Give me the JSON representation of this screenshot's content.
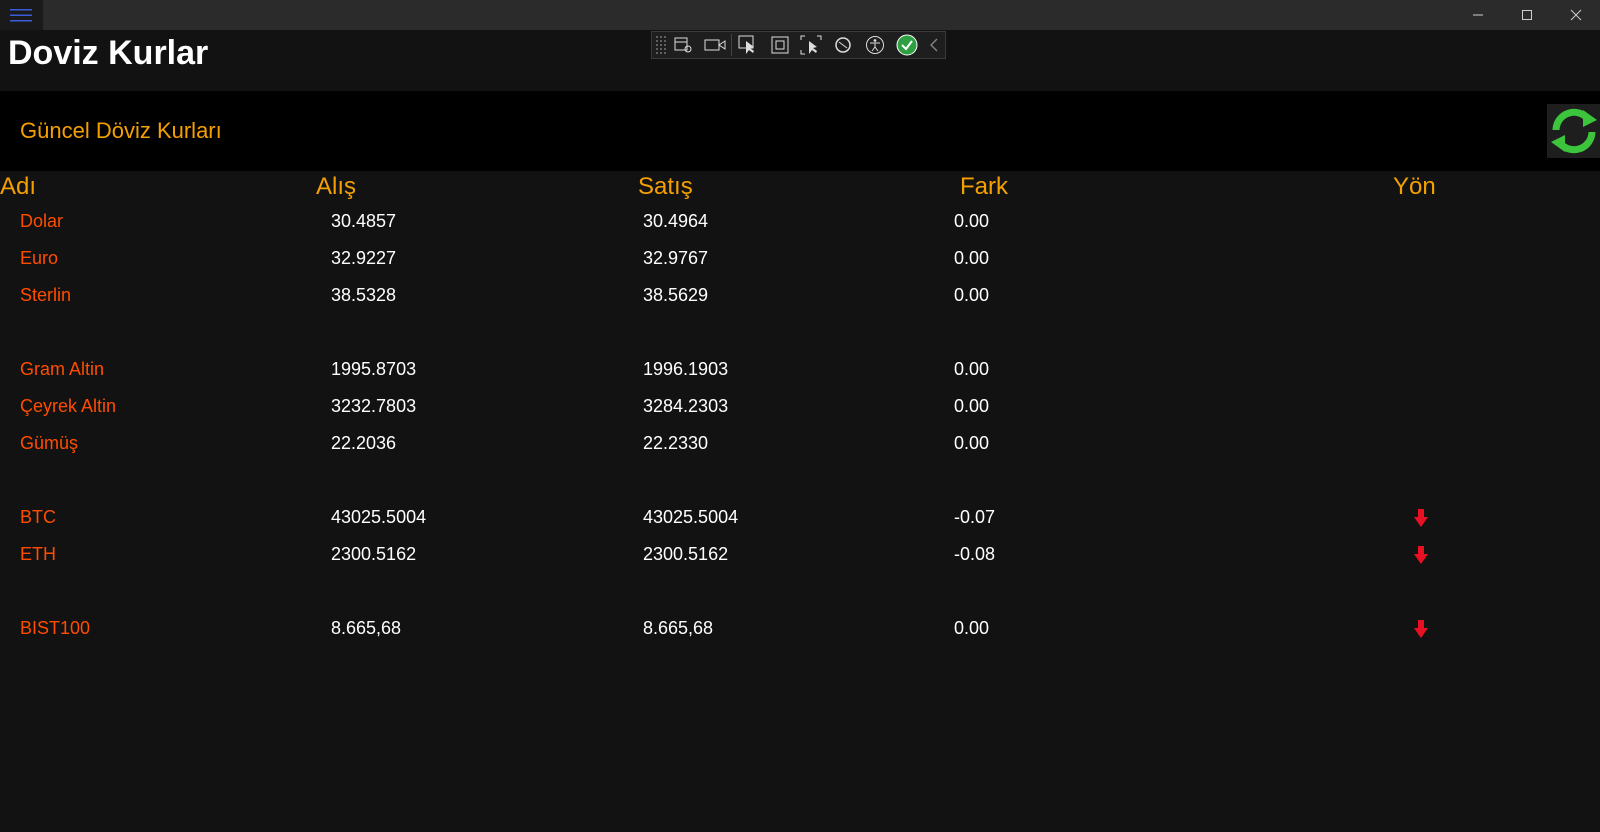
{
  "window": {
    "title": "Doviz Kurlar"
  },
  "devtools": {
    "icons": [
      "live-visual-tree-icon",
      "record-icon",
      "select-element-icon",
      "layout-adorner-icon",
      "track-focus-icon",
      "binding-failures-icon",
      "accessibility-icon",
      "check-icon",
      "collapse-icon"
    ]
  },
  "header": {
    "section_title": "Güncel Döviz Kurları",
    "refresh_icon": "refresh-icon",
    "accent_color": "#f5a000"
  },
  "table": {
    "columns": [
      "Adı",
      "Alış",
      "Satış",
      "Fark",
      "Yön"
    ],
    "rows": [
      {
        "name": "Dolar",
        "buy": "30.4857",
        "sell": "30.4964",
        "diff": "0.00",
        "direction": ""
      },
      {
        "name": "Euro",
        "buy": "32.9227",
        "sell": "32.9767",
        "diff": "0.00",
        "direction": ""
      },
      {
        "name": "Sterlin",
        "buy": "38.5328",
        "sell": "38.5629",
        "diff": "0.00",
        "direction": ""
      },
      {
        "name": "Gram Altin",
        "buy": "1995.8703",
        "sell": "1996.1903",
        "diff": "0.00",
        "direction": ""
      },
      {
        "name": "Çeyrek Altin",
        "buy": "3232.7803",
        "sell": "3284.2303",
        "diff": "0.00",
        "direction": ""
      },
      {
        "name": "Gümüş",
        "buy": "22.2036",
        "sell": "22.2330",
        "diff": "0.00",
        "direction": ""
      },
      {
        "name": "BTC",
        "buy": "43025.5004",
        "sell": "43025.5004",
        "diff": "-0.07",
        "direction": "down"
      },
      {
        "name": "ETH",
        "buy": "2300.5162",
        "sell": "2300.5162",
        "diff": "-0.08",
        "direction": "down"
      },
      {
        "name": "BIST100",
        "buy": "8.665,68",
        "sell": "8.665,68",
        "diff": "0.00",
        "direction": "down"
      }
    ],
    "name_color": "#ff4d00",
    "down_arrow_color": "#e81123"
  }
}
